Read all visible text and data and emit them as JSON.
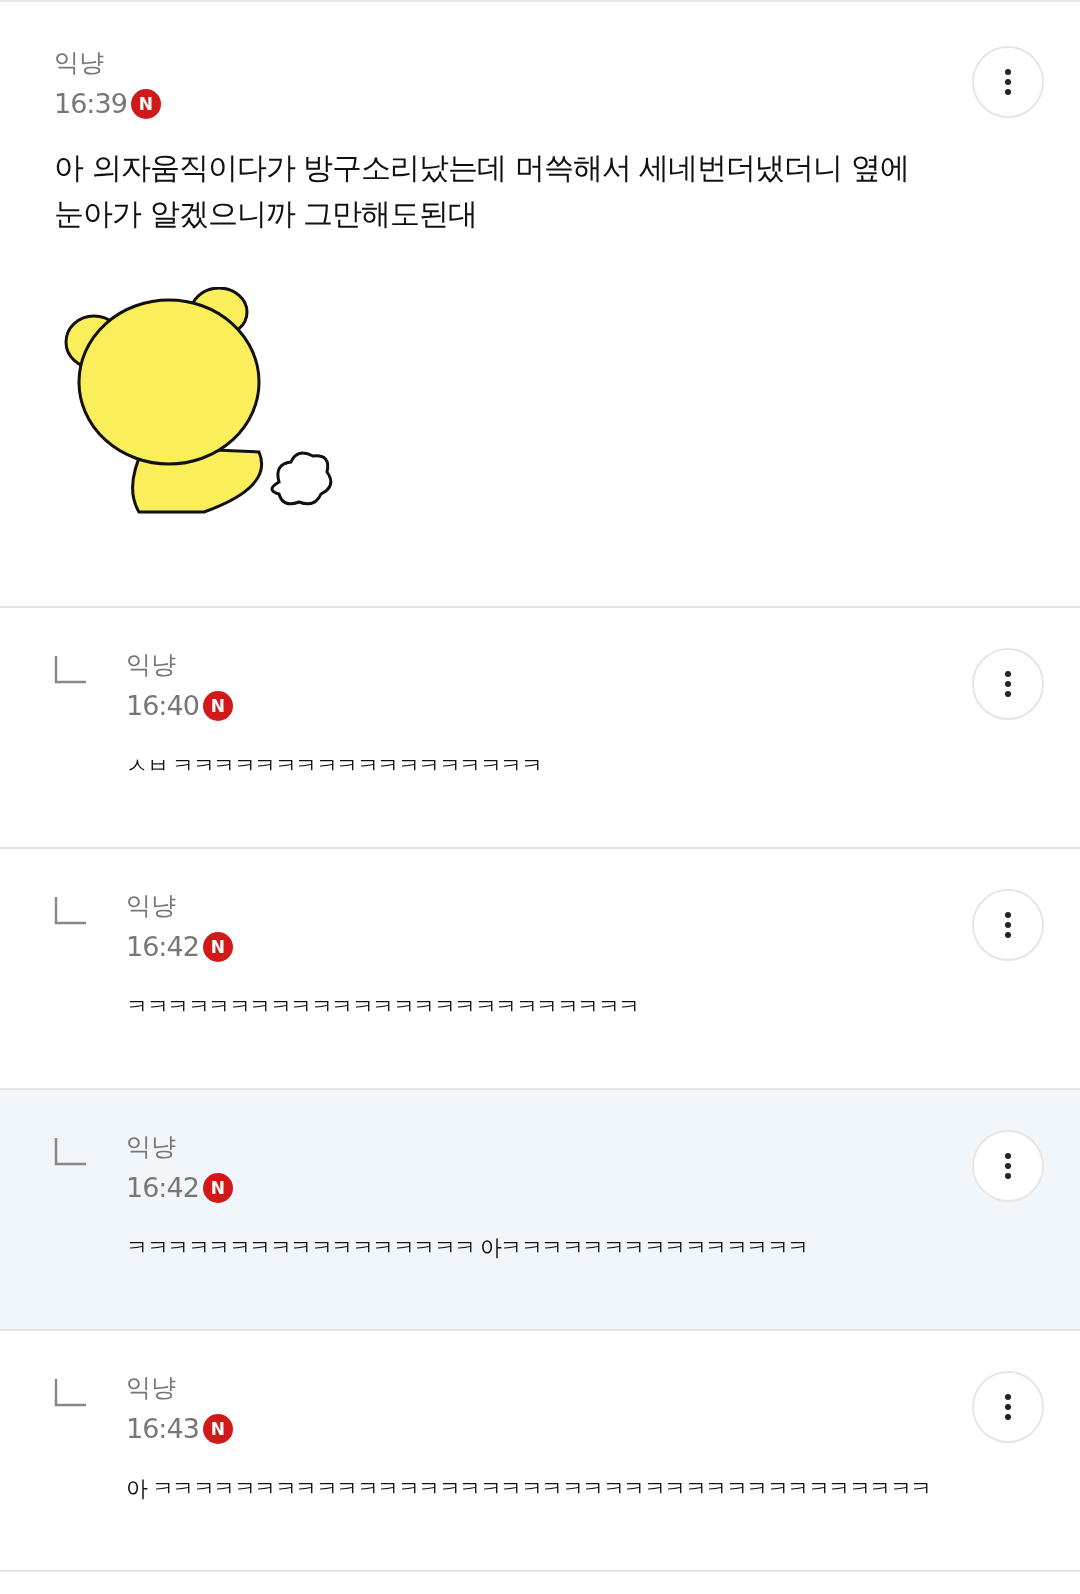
{
  "comments": [
    {
      "kind": "comment",
      "author": "익냥",
      "time": "16:39",
      "badge": "N",
      "text": "아 의자움직이다가 방구소리났는데 머쓱해서 세네번더냈더니 옆에 눈아가 알겠으니까 그만해도된대",
      "selected": false
    },
    {
      "kind": "reply",
      "author": "익냥",
      "time": "16:40",
      "badge": "N",
      "text": "ㅅㅂ ㅋㅋㅋㅋㅋㅋㅋㅋㅋㅋㅋㅋㅋㅋㅋㅋㅋㅋ",
      "selected": false
    },
    {
      "kind": "reply",
      "author": "익냥",
      "time": "16:42",
      "badge": "N",
      "text": "ㅋㅋㅋㅋㅋㅋㅋㅋㅋㅋㅋㅋㅋㅋㅋㅋㅋㅋㅋㅋㅋㅋㅋㅋㅋ",
      "selected": false
    },
    {
      "kind": "reply",
      "author": "익냥",
      "time": "16:42",
      "badge": "N",
      "text": "ㅋㅋㅋㅋㅋㅋㅋㅋㅋㅋㅋㅋㅋㅋㅋㅋㅋ 아ㅋㅋㅋㅋㅋㅋㅋㅋㅋㅋㅋㅋㅋㅋㅋ",
      "selected": true
    },
    {
      "kind": "reply",
      "author": "익냥",
      "time": "16:43",
      "badge": "N",
      "text": "아 ㅋㅋㅋㅋㅋㅋㅋㅋㅋㅋㅋㅋㅋㅋㅋㅋㅋㅋㅋㅋㅋㅋㅋㅋㅋㅋㅋㅋㅋㅋㅋㅋㅋㅋㅋㅋㅋㅋ",
      "selected": false
    }
  ]
}
